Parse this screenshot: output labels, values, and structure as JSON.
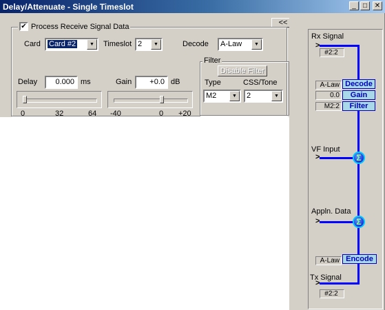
{
  "window": {
    "title": "Delay/Attenuate - Single Timeslot",
    "minimize_glyph": "_",
    "maximize_glyph": "□",
    "close_glyph": "✕"
  },
  "main": {
    "process_checkbox": {
      "label": "Process Receive Signal Data",
      "checked": true,
      "glyph": "✔"
    },
    "collapse_button": "<<",
    "card": {
      "label": "Card",
      "value": "Card #2"
    },
    "timeslot": {
      "label": "Timeslot",
      "value": "2"
    },
    "decode": {
      "label": "Decode",
      "value": "A-Law"
    },
    "delay": {
      "label": "Delay",
      "value": "0.000",
      "unit": "ms",
      "scale": [
        "0",
        "32",
        "64"
      ],
      "slider_fraction": 0.0
    },
    "gain": {
      "label": "Gain",
      "value": "+0.0",
      "unit": "dB",
      "scale": [
        "-40",
        "0",
        "+20"
      ],
      "slider_fraction": 0.667
    },
    "filter": {
      "group_label": "Filter",
      "disable_button": "Disable Filter",
      "type_label": "Type",
      "type_value": "M2",
      "tone_label": "CSS/Tone",
      "tone_value": "2"
    },
    "dropdown_glyph": "▼"
  },
  "flow": {
    "rx_label": "Rx Signal",
    "rx_value": "#2:2",
    "decode_value": "A-Law",
    "decode_label": "Decode",
    "gain_value": "0.0",
    "gain_label": "Gain",
    "filter_value": "M2:2",
    "filter_label": "Filter",
    "vf_label": "VF Input",
    "appln_label": "Appln. Data",
    "sum_glyph": "Σ",
    "encode_value": "A-Law",
    "encode_label": "Encode",
    "tx_label": "Tx Signal",
    "tx_value": "#2:2",
    "arrow_glyph": ">",
    "line_color": "#0000ff",
    "label_fill": "#a8d8ea"
  }
}
